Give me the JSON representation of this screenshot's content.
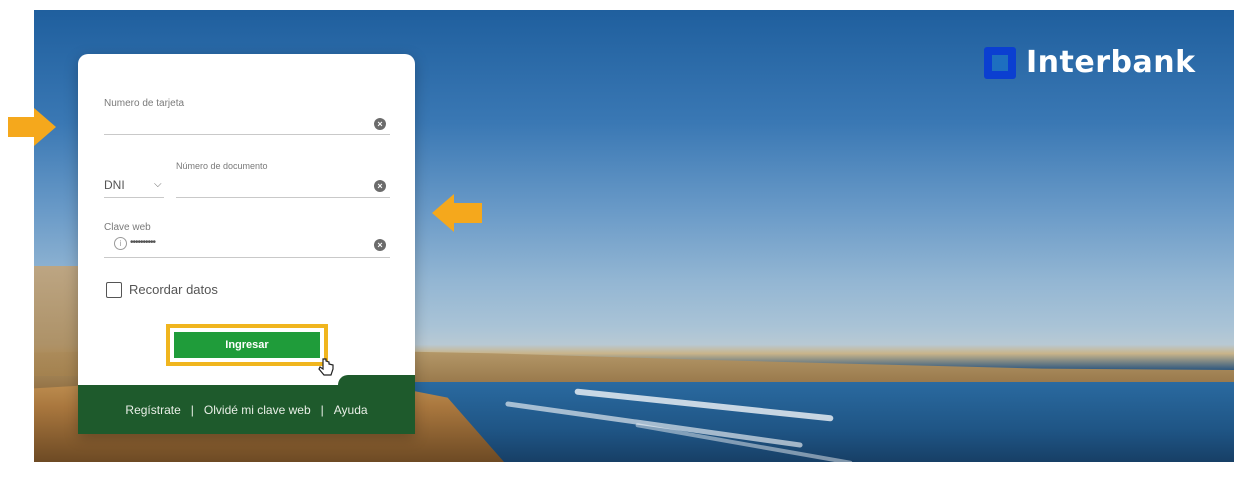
{
  "brand": {
    "name": "Interbank",
    "logo_color": "#0b3fd1"
  },
  "login": {
    "card_number": {
      "label": "Numero de tarjeta",
      "value": ""
    },
    "document": {
      "type_value": "DNI",
      "label": "Número de documento",
      "value": ""
    },
    "password": {
      "label": "Clave web",
      "value": "••••••••••"
    },
    "remember": {
      "label": "Recordar datos",
      "checked": false
    },
    "submit_label": "Ingresar",
    "submit_color": "#1f9c3a",
    "highlight_color": "#f0b51e"
  },
  "footer": {
    "register": "Regístrate",
    "separator": "|",
    "forgot": "Olvidé mi clave web",
    "help": "Ayuda",
    "background": "#1e5a2c"
  },
  "annotations": {
    "arrow_color": "#f5a81c"
  }
}
